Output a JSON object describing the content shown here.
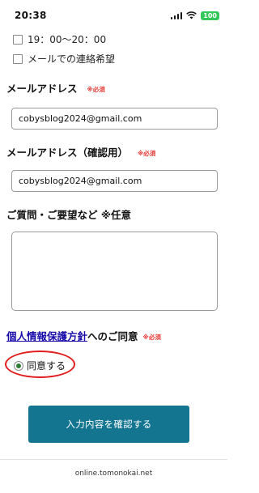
{
  "status_bar": {
    "time": "20:38",
    "battery": "100",
    "battery_color": "#34c759"
  },
  "time_options": [
    {
      "label": "19：00〜20：00"
    },
    {
      "label": "メールでの連絡希望"
    }
  ],
  "email": {
    "label": "メールアドレス",
    "required": "※必須",
    "value": "cobysblog2024@gmail.com"
  },
  "email_confirm": {
    "label": "メールアドレス（確認用）",
    "required": "※必須",
    "value": "cobysblog2024@gmail.com"
  },
  "inquiry": {
    "label": "ご質問・ご要望など ※任意",
    "value": ""
  },
  "privacy": {
    "link_text": "個人情報保護方針",
    "suffix": "へのご同意",
    "required": "※必須"
  },
  "agree": {
    "label": "同意する",
    "selected": true,
    "highlight_color": "#e21d1d"
  },
  "submit": {
    "label": "入力内容を確認する",
    "color": "#147590"
  },
  "footer": {
    "domain": "online.tomonokai.net"
  }
}
